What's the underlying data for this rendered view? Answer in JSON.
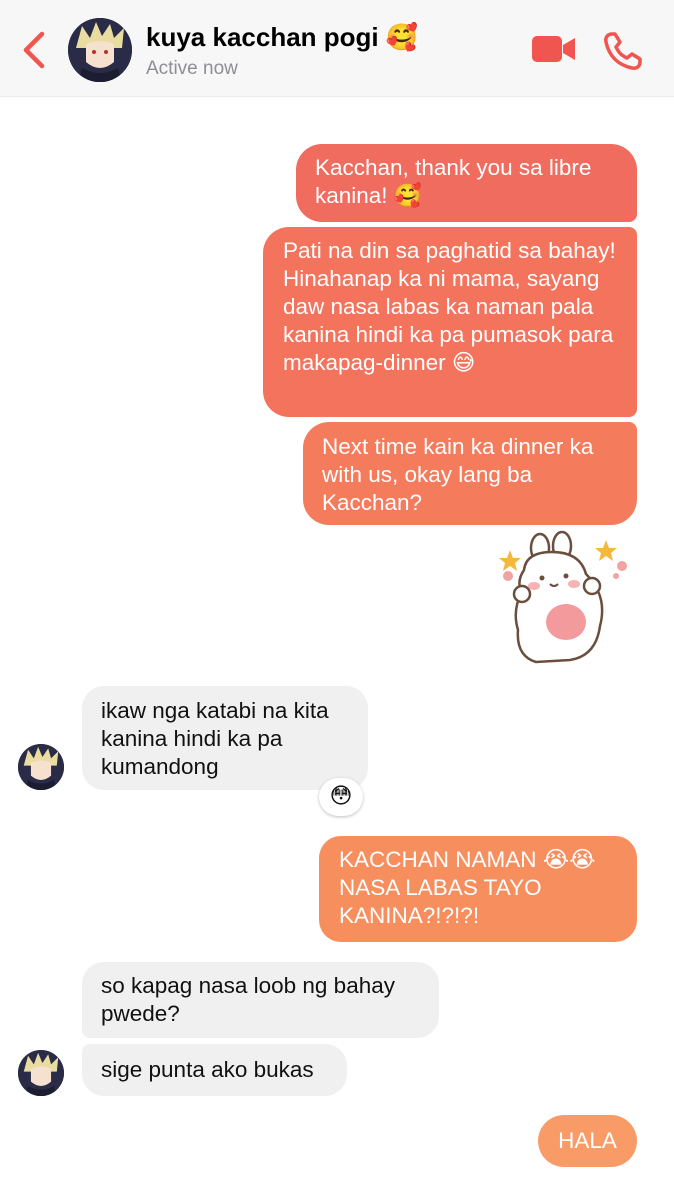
{
  "header": {
    "contact_name": "kuya kacchan pogi 🥰",
    "status": "Active now"
  },
  "messages": [
    {
      "from": "me",
      "text": "Kacchan, thank you sa libre kanina! 🥰"
    },
    {
      "from": "me",
      "text": "Pati na din sa paghatid sa bahay! Hinahanap ka ni mama, sayang daw nasa labas ka naman pala kanina hindi ka pa pumasok para makapag-dinner 😅"
    },
    {
      "from": "me",
      "text": "Next time kain ka dinner ka with us, okay lang ba Kacchan?"
    },
    {
      "from": "them",
      "text": "ikaw nga katabi na kita kanina hindi ka pa kumandong",
      "reaction": "😳"
    },
    {
      "from": "me",
      "text": "KACCHAN NAMAN 😭😭 NASA LABAS TAYO KANINA?!?!?!"
    },
    {
      "from": "them",
      "text": "so kapag nasa loob ng bahay pwede?"
    },
    {
      "from": "them",
      "text": "sige punta ako bukas"
    },
    {
      "from": "me",
      "text": "HALA"
    }
  ],
  "icons": {
    "back": "chevron-left-icon",
    "video": "video-camera-icon",
    "call": "phone-icon",
    "sticker": "bunny-sticker"
  },
  "colors": {
    "accent": "#f0554f",
    "bubble_gradient": [
      "#f06c5e",
      "#f3735d",
      "#f57b5d",
      "#f78e5e",
      "#f89b67"
    ],
    "incoming_bubble": "#f0f0f0"
  }
}
